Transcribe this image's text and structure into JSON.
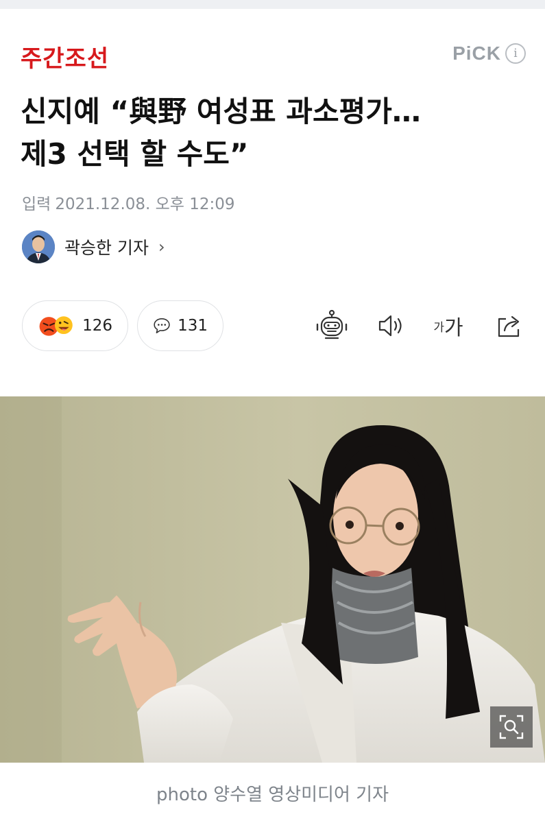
{
  "press": {
    "name": "주간조선",
    "brand_color": "#d7191c"
  },
  "pick": {
    "label": "PiCK",
    "info_icon": "i"
  },
  "article": {
    "headline_line1": "신지예 “與野 여성표 과소평가…",
    "headline_line2": "제3 선택 할 수도”",
    "date_label": "입력",
    "date_value": "2021.12.08. 오후 12:09"
  },
  "reporter": {
    "name": "곽승한 기자",
    "chevron": "›"
  },
  "reactions": {
    "count": "126"
  },
  "comments": {
    "count": "131"
  },
  "toolbar": {
    "font_small": "가",
    "font_big": "가"
  },
  "photo": {
    "caption": "photo 양수열 영상미디어 기자"
  },
  "colors": {
    "muted_text": "#8a8f96",
    "border": "#dfe1e4",
    "background": "#ffffff"
  }
}
